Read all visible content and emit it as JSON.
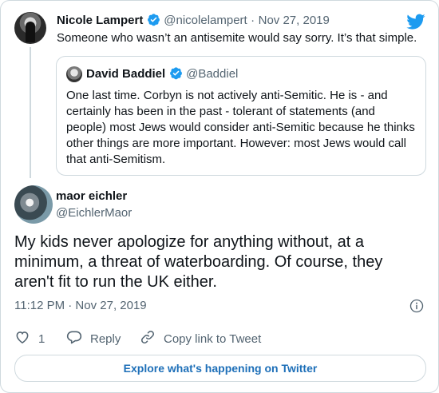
{
  "parent_tweet": {
    "display_name": "Nicole Lampert",
    "handle": "@nicolelampert",
    "date": "Nov 27, 2019",
    "text": "Someone who wasn’t an antisemite would say sorry. It’s that simple."
  },
  "quoted_tweet": {
    "display_name": "David Baddiel",
    "handle": "@Baddiel",
    "text": "One last time. Corbyn is not actively anti-Semitic. He is - and certainly has been in the past - tolerant of statements (and people) most Jews would consider anti-Semitic because he thinks other things are more important. However: most Jews would call that anti-Semitism."
  },
  "main_tweet": {
    "display_name": "maor eichler",
    "handle": "@EichlerMaor",
    "text": "My kids never apologize for anything without, at a minimum, a threat of waterboarding. Of course, they aren't fit to run the UK either.",
    "timestamp": "11:12 PM · Nov 27, 2019"
  },
  "actions": {
    "like_count": "1",
    "reply_label": "Reply",
    "copy_label": "Copy link to Tweet"
  },
  "footer": {
    "explore_label": "Explore what's happening on Twitter"
  },
  "colors": {
    "brand": "#1d9bf0",
    "link": "#1d6fb8",
    "muted": "#536471",
    "border": "#cfd9de"
  },
  "icons": [
    "twitter-bird-icon",
    "verified-badge-icon",
    "info-icon",
    "heart-icon",
    "reply-icon",
    "link-icon"
  ]
}
